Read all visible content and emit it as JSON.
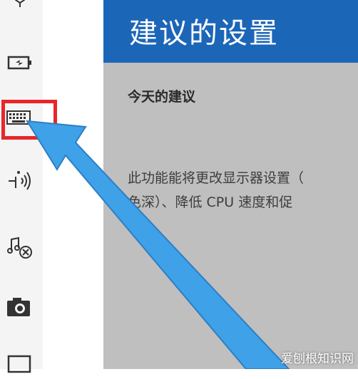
{
  "header": {
    "title": "建议的设置"
  },
  "section": {
    "title": "今天的建议"
  },
  "description": {
    "line1": "此功能能将更改显示器设置（",
    "line2": "色深）、降低 CPU 速度和促"
  },
  "sidebar": {
    "icons": [
      "lightbulb-icon",
      "battery-icon",
      "keyboard-icon",
      "wireless-icon",
      "music-icon",
      "camera-icon",
      "monitor-icon"
    ]
  },
  "watermark": {
    "text": "爱刨根知识网"
  },
  "colors": {
    "header_bg": "#1c66b8",
    "content_bg": "#bfbfbf",
    "highlight": "#e8262a",
    "arrow": "#3fa1e8"
  }
}
